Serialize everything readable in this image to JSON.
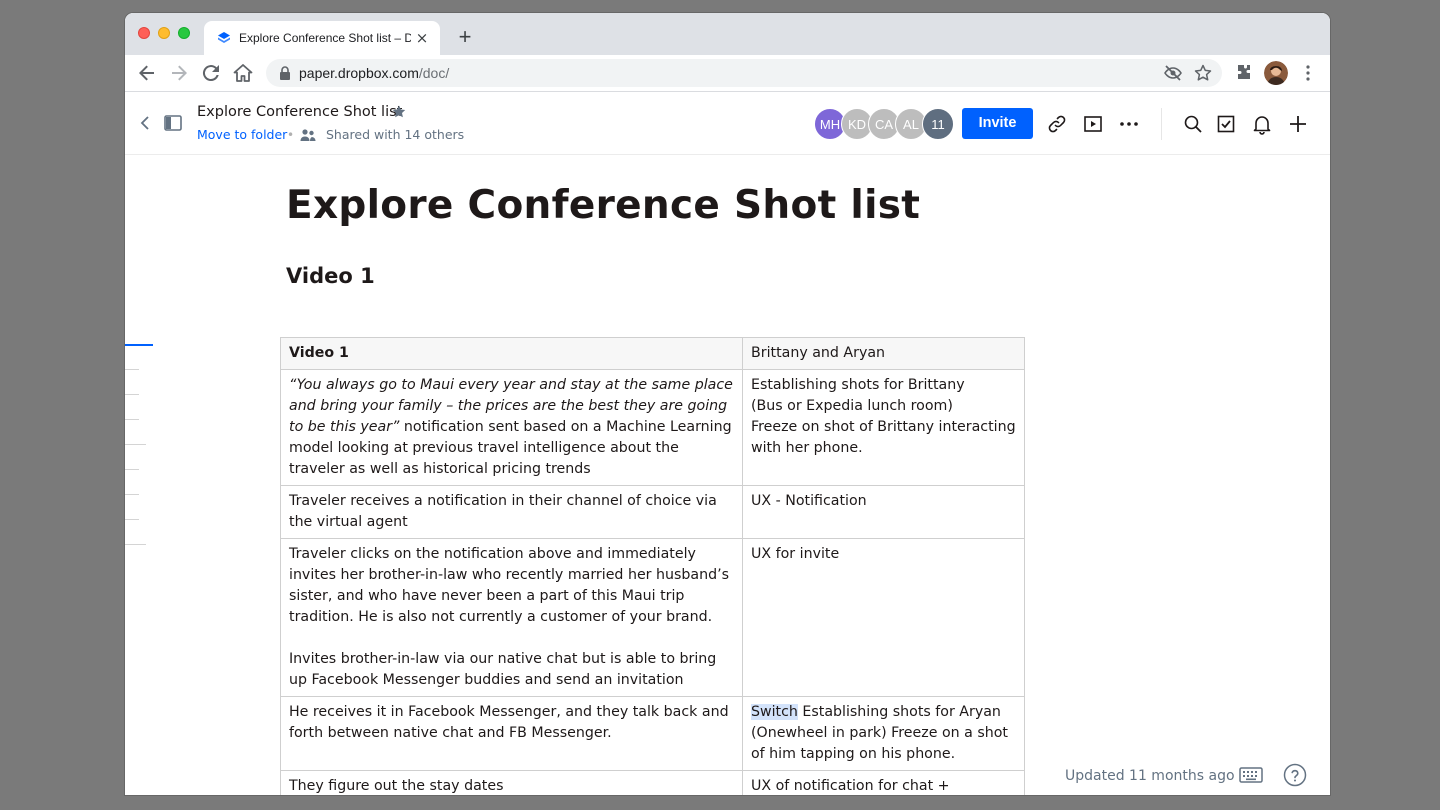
{
  "browser": {
    "tab_title": "Explore Conference Shot list – Dropbox Paper",
    "tab_close": "×",
    "new_tab": "+",
    "url_host": "paper.dropbox.com",
    "url_path": "/doc/"
  },
  "header": {
    "doc_title": "Explore Conference Shot list",
    "move_to_folder": "Move to folder",
    "separator": "•",
    "shared_with": "Shared with 14 others",
    "avatars": [
      {
        "initials": "MH",
        "color": "#7e67d8"
      },
      {
        "initials": "KD",
        "color": "#bdbdbd"
      },
      {
        "initials": "CA",
        "color": "#bdbdbd"
      },
      {
        "initials": "AL",
        "color": "#bdbdbd"
      },
      {
        "initials": "11",
        "color": "#5f6e80"
      }
    ],
    "invite_label": "Invite",
    "accent_color": "#0061fe"
  },
  "document": {
    "title": "Explore Conference Shot list",
    "section_heading": "Video 1",
    "table": {
      "header": [
        "Video 1",
        "Brittany and Aryan"
      ],
      "rows": [
        {
          "left_italic": "“You always go to Maui every year and stay at the same place and bring your family – the prices are the best they are going to be this year”",
          "left_rest": " notification sent based on a Machine Learning model looking at previous travel intelligence about the traveler as well as historical pricing trends",
          "right_lines": [
            "Establishing shots for Brittany",
            "(Bus or Expedia lunch room)",
            "Freeze on shot of Brittany interacting with her phone."
          ]
        },
        {
          "left": "Traveler receives a notification in their channel of choice via the virtual agent",
          "right": "UX - Notification"
        },
        {
          "left_p1": "Traveler clicks on the notification above and immediately invites her brother-in-law who recently married her husband’s sister, and who have never been a part of this Maui trip tradition. He is also not currently a customer of your brand.",
          "left_p2": "Invites brother-in-law via our native chat but is able to bring up Facebook Messenger buddies and send an invitation",
          "right": "UX for invite"
        },
        {
          "left": "He receives it in Facebook Messenger, and they talk back and forth between native chat and FB Messenger.",
          "right_highlight": "Switch",
          "right_rest": " Establishing shots for Aryan (Onewheel in park) Freeze on a shot of him tapping on his phone."
        },
        {
          "left": "They figure out the stay dates",
          "right": "UX of notification for chat + response on dates"
        }
      ]
    }
  },
  "footer": {
    "updated": "Updated 11 months ago"
  }
}
